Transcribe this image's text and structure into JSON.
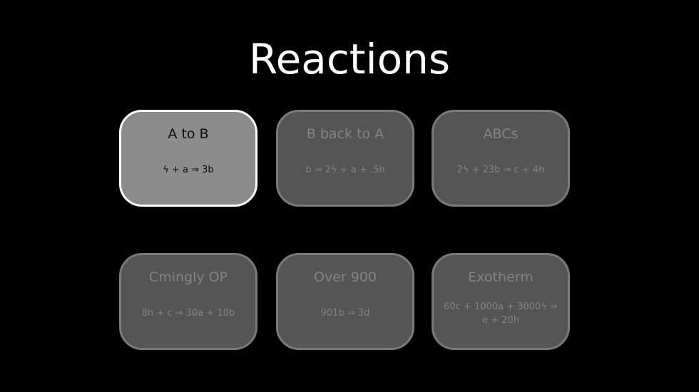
{
  "title": "Reactions",
  "colors": {
    "background": "#000000",
    "card_bg": "#555555",
    "card_border": "#7a7a7a",
    "card_text": "#848484",
    "selected_bg": "#8c8c8c",
    "selected_border": "#ffffff",
    "selected_text": "#0c0c0c"
  },
  "reactions": [
    {
      "name": "A to B",
      "equation": "ϟ + a ⇒ 3b",
      "selected": true
    },
    {
      "name": "B back to A",
      "equation": "b ⇒ 2ϟ + a + .5h",
      "selected": false
    },
    {
      "name": "ABCs",
      "equation": "2ϟ + 23b ⇒ c + 4h",
      "selected": false
    },
    {
      "name": "Cmingly OP",
      "equation": "8h + c ⇒ 30a + 10b",
      "selected": false
    },
    {
      "name": "Over 900",
      "equation": "901b ⇒ 3d",
      "selected": false
    },
    {
      "name": "Exotherm",
      "equation": "60c + 1000a + 3000ϟ ⇒ e + 20h",
      "selected": false
    }
  ]
}
